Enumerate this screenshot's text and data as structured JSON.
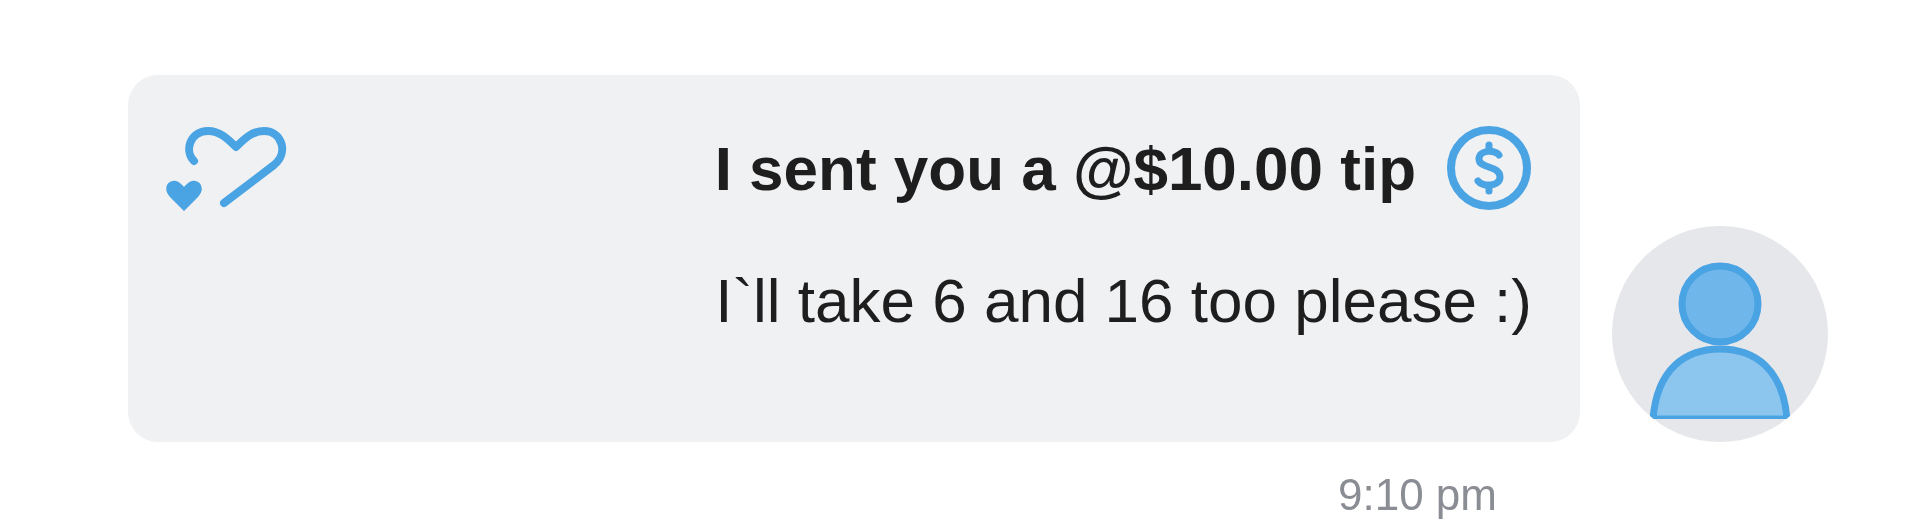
{
  "message": {
    "tip_text": "I sent you a @$10.00 tip",
    "text": "I`ll take 6 and 16 too please :)",
    "time": "9:10 pm"
  }
}
